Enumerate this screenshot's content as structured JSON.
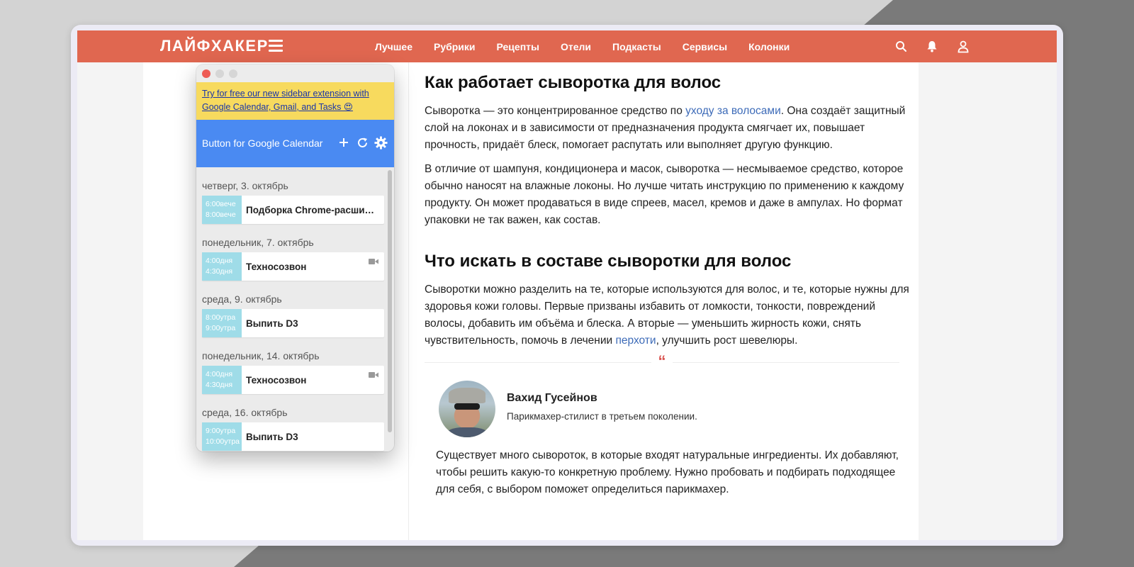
{
  "site": {
    "logo": "ЛАЙФХАКЕР",
    "nav": [
      "Лучшее",
      "Рубрики",
      "Рецепты",
      "Отели",
      "Подкасты",
      "Сервисы",
      "Колонки"
    ],
    "accent": "#e06750"
  },
  "article": {
    "h1": "Как работает сыворотка для волос",
    "p1_before": "Сыворотка — это концентрированное средство по ",
    "p1_link": "уходу за волосами",
    "p1_after": ". Она создаёт защитный слой на локонах и в зависимости от предназначения продукта смягчает их, повышает прочность, придаёт блеск, помогает распутать или выполняет другую функцию.",
    "p2": "В отличие от шампуня, кондиционера и масок, сыворотка — несмываемое средство, которое обычно наносят на влажные локоны. Но лучше читать инструкцию по применению к каждому продукту. Он может продаваться в виде спреев, масел, кремов и даже в ампулах. Но формат упаковки не так важен, как состав.",
    "h2": "Что искать в составе сыворотки для волос",
    "p3_before": "Сыворотки можно разделить на те, которые используются для волос, и те, которые нужны для здоровья кожи головы. Первые призваны избавить от ломкости, тонкости, повреждений волосы, добавить им объёма и блеска. А вторые — уменьшить жирность кожи, снять чувствительность, помочь в лечении ",
    "p3_link": "перхоти",
    "p3_after": ", улучшить рост шевелюры.",
    "quote_mark": "“",
    "expert_name": "Вахид Гусейнов",
    "expert_role": "Парикмахер-стилист в третьем поколении.",
    "quote": "Существует много сывороток, в которые входят натуральные ингредиенты. Их добавляют, чтобы решить какую-то конкретную проблему. Нужно пробовать и подбирать подходящее для себя, с выбором поможет определиться парикмахер.",
    "link_color": "#3d6bb8"
  },
  "popup": {
    "banner": "Try for free our new sidebar extension with Google Calendar, Gmail, and Tasks 😍",
    "title": "Button for Google Calendar",
    "header_color": "#4a8af2",
    "banner_color": "#f7da5e",
    "event_time_color": "#9fdce8",
    "days": [
      {
        "label": "четверг, 3. октябрь",
        "time1": "6:00вече",
        "time2": "8:00вече",
        "title": "Подборка Chrome-расширений",
        "video": false
      },
      {
        "label": "понедельник, 7. октябрь",
        "time1": "4:00дня",
        "time2": "4:30дня",
        "title": "Техносозвон",
        "video": true
      },
      {
        "label": "среда, 9. октябрь",
        "time1": "8:00утра",
        "time2": "9:00утра",
        "title": "Выпить D3",
        "video": false
      },
      {
        "label": "понедельник, 14. октябрь",
        "time1": "4:00дня",
        "time2": "4:30дня",
        "title": "Техносозвон",
        "video": true
      },
      {
        "label": "среда, 16. октябрь",
        "time1": "9:00утра",
        "time2": "10:00утра",
        "title": "Выпить D3",
        "video": false
      }
    ]
  }
}
